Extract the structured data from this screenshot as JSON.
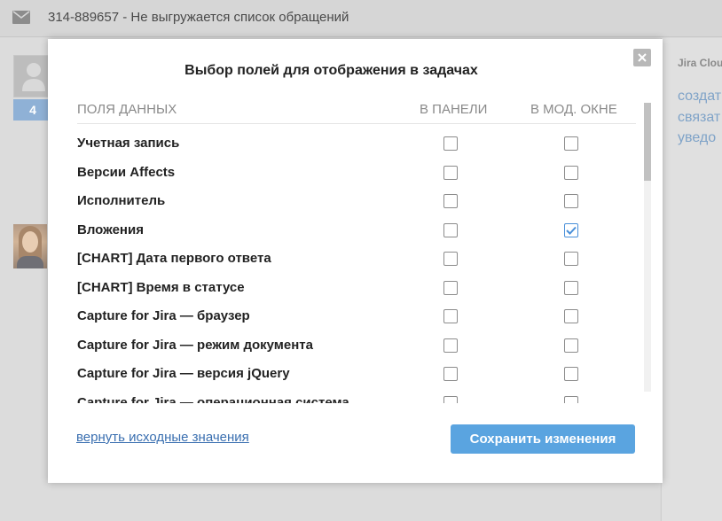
{
  "header": {
    "title": "314-889657 - Не выгружается список обращений",
    "icon": "mail-icon"
  },
  "left_panel": {
    "badge_count": "4"
  },
  "right_panel": {
    "title": "Jira Clou",
    "links": [
      "создат",
      "связат",
      "уведо"
    ]
  },
  "modal": {
    "title": "Выбор полей для отображения в задачах",
    "columns": {
      "field": "ПОЛЯ ДАННЫХ",
      "panel": "В ПАНЕЛИ",
      "modal": "В МОД. ОКНЕ"
    },
    "rows": [
      {
        "label": "Учетная запись",
        "panel": false,
        "modal": false
      },
      {
        "label": "Версии Affects",
        "panel": false,
        "modal": false
      },
      {
        "label": "Исполнитель",
        "panel": false,
        "modal": false
      },
      {
        "label": "Вложения",
        "panel": false,
        "modal": true
      },
      {
        "label": "[CHART] Дата первого ответа",
        "panel": false,
        "modal": false
      },
      {
        "label": "[CHART] Время в статусе",
        "panel": false,
        "modal": false
      },
      {
        "label": "Capture for Jira — браузер",
        "panel": false,
        "modal": false
      },
      {
        "label": "Capture for Jira — режим документа",
        "panel": false,
        "modal": false
      },
      {
        "label": "Capture for Jira — версия jQuery",
        "panel": false,
        "modal": false
      },
      {
        "label": "Capture for Jira — операционная система",
        "panel": false,
        "modal": false
      }
    ],
    "reset_label": "вернуть исходные значения",
    "save_label": "Сохранить изменения"
  },
  "colors": {
    "accent": "#5aa4e0",
    "link": "#3a6fb0",
    "checkbox_checked": "#4a90d9"
  }
}
